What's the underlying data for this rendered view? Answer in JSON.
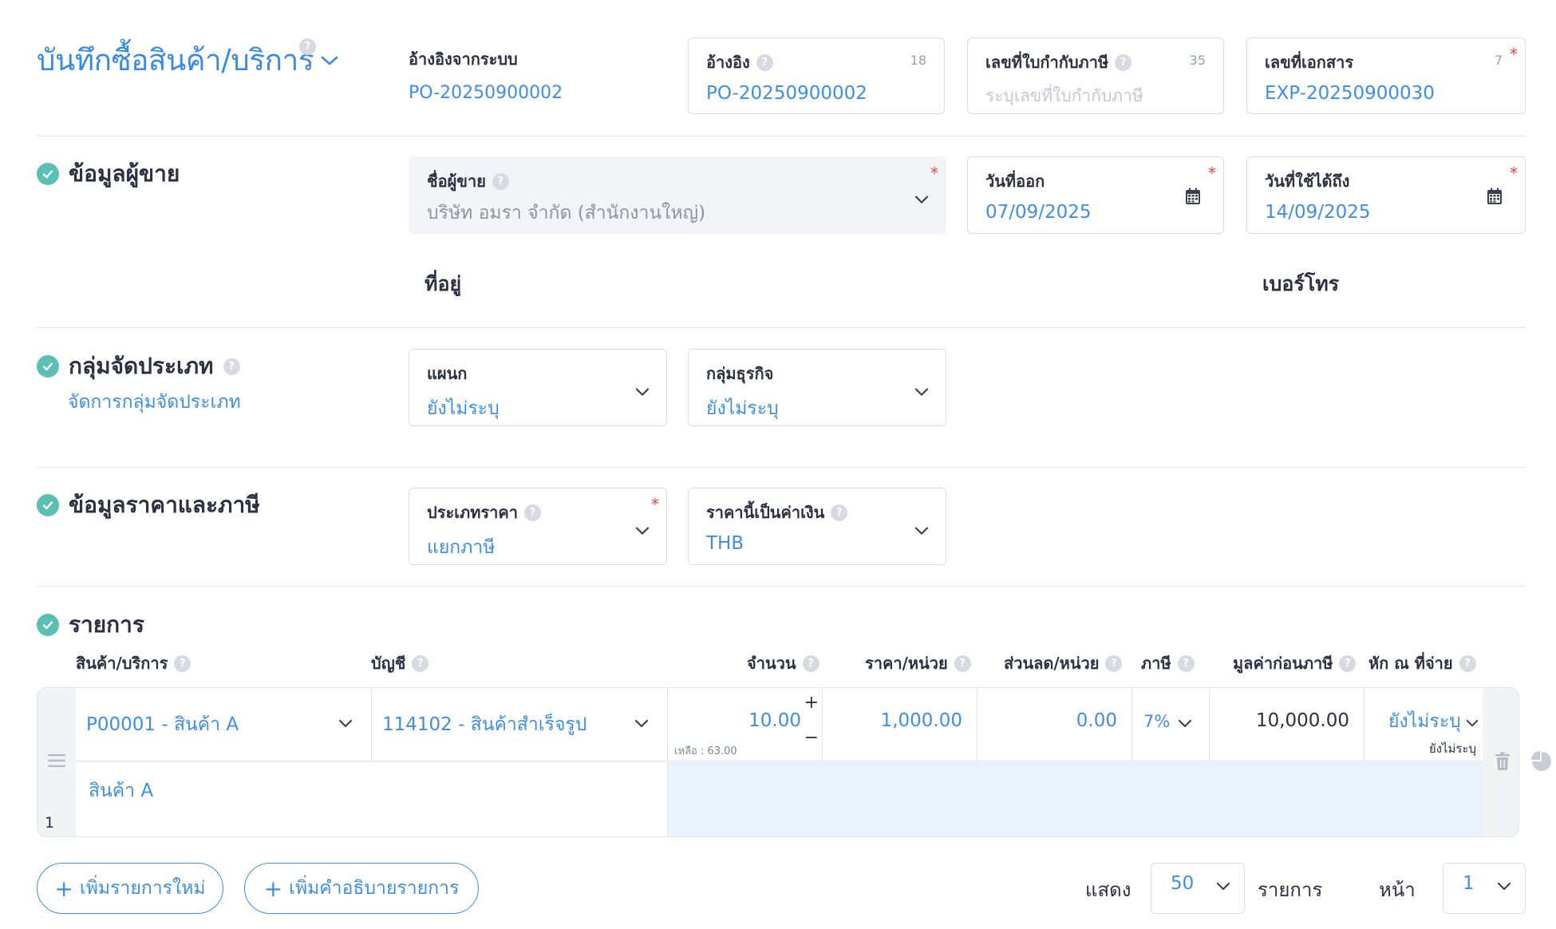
{
  "header": {
    "title": "บันทึกซื้อสินค้า/บริการ",
    "system_ref_label": "อ้างอิงจากระบบ",
    "system_ref_value": "PO-20250900002",
    "ref_field": {
      "label": "อ้างอิง",
      "count": "18",
      "value": "PO-20250900002"
    },
    "tax_invoice_field": {
      "label": "เลขที่ใบกำกับภาษี",
      "count": "35",
      "placeholder": "ระบุเลขที่ใบกำกับภาษี"
    },
    "doc_no_field": {
      "label": "เลขที่เอกสาร",
      "count": "7",
      "value": "EXP-20250900030"
    }
  },
  "vendor": {
    "section_title": "ข้อมูลผู้ขาย",
    "name_label": "ชื่อผู้ขาย",
    "name_value": "บริษัท อมรา จำกัด (สำนักงานใหญ่)",
    "issue_date_label": "วันที่ออก",
    "issue_date_value": "07/09/2025",
    "valid_until_label": "วันที่ใช้ได้ถึง",
    "valid_until_value": "14/09/2025",
    "address_label": "ที่อยู่",
    "phone_label": "เบอร์โทร"
  },
  "category": {
    "section_title": "กลุ่มจัดประเภท",
    "manage_link": "จัดการกลุ่มจัดประเภท",
    "department_label": "แผนก",
    "department_value": "ยังไม่ระบุ",
    "business_group_label": "กลุ่มธุรกิจ",
    "business_group_value": "ยังไม่ระบุ"
  },
  "pricing": {
    "section_title": "ข้อมูลราคาและภาษี",
    "price_type_label": "ประเภทราคา",
    "price_type_value": "แยกภาษี",
    "currency_label": "ราคานี้เป็นค่าเงิน",
    "currency_value": "THB"
  },
  "items": {
    "section_title": "รายการ",
    "columns": {
      "product": "สินค้า/บริการ",
      "account": "บัญชี",
      "qty": "จำนวน",
      "unit_price": "ราคา/หน่วย",
      "discount": "ส่วนลด/หน่วย",
      "tax": "ภาษี",
      "pretax": "มูลค่าก่อนภาษี",
      "withholding": "หัก ณ ที่จ่าย"
    },
    "rows": [
      {
        "index": "1",
        "product": "P00001 - สินค้า A",
        "account": "114102 - สินค้าสำเร็จรูป",
        "qty": "10.00",
        "remaining": "เหลือ : 63.00",
        "unit_price": "1,000.00",
        "discount": "0.00",
        "tax": "7%",
        "pretax": "10,000.00",
        "withholding": "ยังไม่ระบุ",
        "withholding_sub": "ยังไม่ระบุ",
        "description": "สินค้า A"
      }
    ],
    "add_item_button": "เพิ่มรายการใหม่",
    "add_desc_button": "เพิ่มคำอธิบายรายการ"
  },
  "pager": {
    "show_label": "แสดง",
    "page_size": "50",
    "items_label": "รายการ",
    "page_label": "หน้า",
    "page_value": "1"
  },
  "colors": {
    "accent": "#3d8ee6",
    "check": "#5cbfb4",
    "required": "#e8443a",
    "desc_row_bg": "#e9f1fd"
  }
}
